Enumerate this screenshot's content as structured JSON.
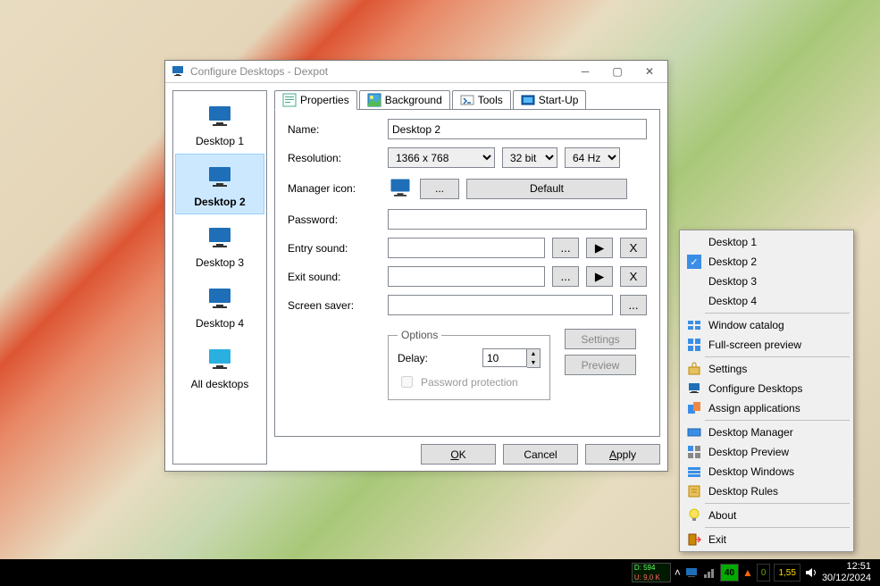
{
  "window": {
    "title": "Configure Desktops - Dexpot"
  },
  "sidebar": {
    "items": [
      {
        "label": "Desktop 1",
        "selected": false,
        "all": false
      },
      {
        "label": "Desktop 2",
        "selected": true,
        "all": false
      },
      {
        "label": "Desktop 3",
        "selected": false,
        "all": false
      },
      {
        "label": "Desktop 4",
        "selected": false,
        "all": false
      },
      {
        "label": "All desktops",
        "selected": false,
        "all": true
      }
    ]
  },
  "tabs": {
    "properties": "Properties",
    "background": "Background",
    "tools": "Tools",
    "startup": "Start-Up"
  },
  "form": {
    "name_label": "Name:",
    "name_value": "Desktop 2",
    "resolution_label": "Resolution:",
    "resolution_value": "1366 x 768",
    "bits_value": "32 bit",
    "refresh_value": "64 Hz",
    "manager_label": "Manager icon:",
    "browse": "...",
    "default": "Default",
    "password_label": "Password:",
    "password_value": "",
    "entry_label": "Entry sound:",
    "entry_value": "",
    "exit_label": "Exit sound:",
    "exit_value": "",
    "saver_label": "Screen saver:",
    "saver_value": "",
    "x_label": "X",
    "options_legend": "Options",
    "delay_label": "Delay:",
    "delay_value": "10",
    "pwd_protect": "Password protection",
    "settings_btn": "Settings",
    "preview_btn": "Preview"
  },
  "buttons": {
    "ok_prefix": "",
    "ok": "OK",
    "cancel": "Cancel",
    "apply": "Apply"
  },
  "ctx": {
    "d1": "Desktop 1",
    "d2": "Desktop 2",
    "d3": "Desktop 3",
    "d4": "Desktop 4",
    "window_catalog": "Window catalog",
    "fullscreen": "Full-screen preview",
    "settings": "Settings",
    "configure": "Configure Desktops",
    "assign": "Assign applications",
    "manager": "Desktop Manager",
    "preview": "Desktop Preview",
    "windows": "Desktop Windows",
    "rules": "Desktop Rules",
    "about": "About",
    "exit": "Exit"
  },
  "tray": {
    "net_d": "D: 594",
    "net_u": "U: 9,0 K",
    "num": "40",
    "num2": "1,55",
    "time": "12:51",
    "date": "30/12/2024"
  }
}
